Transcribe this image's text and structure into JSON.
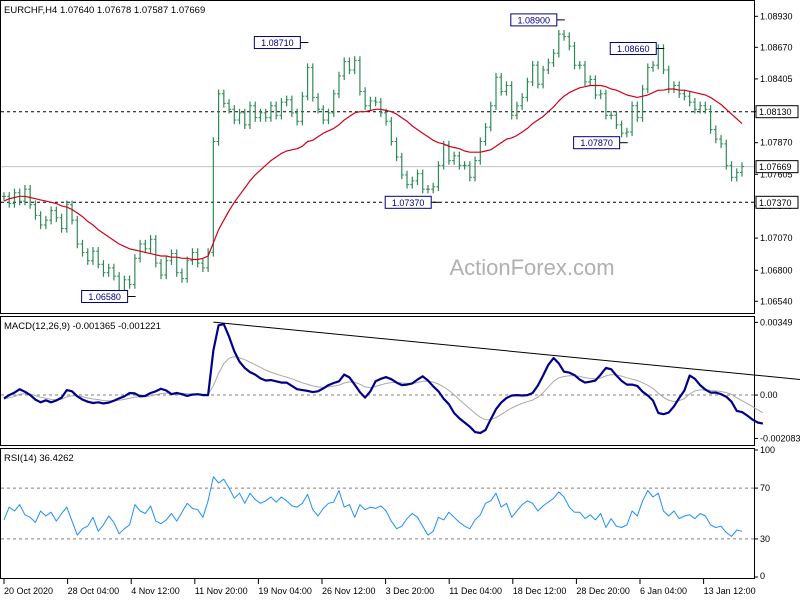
{
  "chart_data": [
    {
      "type": "line",
      "panel": "price",
      "header": "EURCHF,H4  1.07640 1.07678 1.07587 1.07669",
      "symbol": "EURCHF",
      "timeframe": "H4",
      "ohlc_header": {
        "open": 1.0764,
        "high": 1.07678,
        "low": 1.07587,
        "close": 1.07669
      },
      "ylim": [
        1.0645,
        1.0905
      ],
      "y_ticks": [
        "1.08930",
        "1.08670",
        "1.08405",
        "1.08130",
        "1.07870",
        "1.07605",
        "1.07340",
        "1.07070",
        "1.06800",
        "1.06540"
      ],
      "last_price_label": "1.07669",
      "last_price": 1.07669,
      "levels": [
        {
          "label": "1.08130",
          "value": 1.0813
        },
        {
          "label": "1.07370",
          "value": 1.0737
        }
      ],
      "annotations": [
        {
          "text": "1.06580",
          "value": 1.0658,
          "time_index": 24
        },
        {
          "text": "1.08710",
          "value": 1.0871,
          "time_index": 57
        },
        {
          "text": "1.07370",
          "value": 1.0737,
          "time_index": 82
        },
        {
          "text": "1.08900",
          "value": 1.089,
          "time_index": 106
        },
        {
          "text": "1.07870",
          "value": 1.0787,
          "time_index": 118
        },
        {
          "text": "1.08660",
          "value": 1.0866,
          "time_index": 125
        }
      ],
      "series": [
        {
          "name": "Price",
          "values": [
            1.0742,
            1.0736,
            1.0745,
            1.0738,
            1.0748,
            1.0735,
            1.0726,
            1.0718,
            1.0722,
            1.073,
            1.0724,
            1.0715,
            1.0735,
            1.0722,
            1.0702,
            1.0695,
            1.0688,
            1.0696,
            1.0685,
            1.0678,
            1.0682,
            1.0675,
            1.0662,
            1.0672,
            1.0668,
            1.069,
            1.0702,
            1.0698,
            1.0706,
            1.0686,
            1.0676,
            1.0688,
            1.0694,
            1.0678,
            1.0673,
            1.0688,
            1.0695,
            1.0686,
            1.0682,
            1.0695,
            1.0788,
            1.0828,
            1.082,
            1.0815,
            1.0806,
            1.0812,
            1.0802,
            1.0818,
            1.0808,
            1.0812,
            1.0808,
            1.0818,
            1.081,
            1.0821,
            1.0823,
            1.0812,
            1.0805,
            1.0826,
            1.085,
            1.0825,
            1.0815,
            1.0806,
            1.0812,
            1.0828,
            1.0843,
            1.0855,
            1.0848,
            1.0856,
            1.083,
            1.0818,
            1.0822,
            1.0821,
            1.0812,
            1.0805,
            1.0788,
            1.0775,
            1.076,
            1.0752,
            1.0755,
            1.0761,
            1.0748,
            1.0748,
            1.075,
            1.0768,
            1.0785,
            1.0772,
            1.0776,
            1.0768,
            1.0768,
            1.0758,
            1.0772,
            1.0788,
            1.08,
            1.0818,
            1.0842,
            1.083,
            1.0835,
            1.081,
            1.0818,
            1.0825,
            1.0838,
            1.0852,
            1.0836,
            1.0848,
            1.0854,
            1.0862,
            1.0878,
            1.0876,
            1.0868,
            1.0852,
            1.0852,
            1.0838,
            1.084,
            1.0827,
            1.0828,
            1.081,
            1.081,
            1.0802,
            1.0795,
            1.0796,
            1.0818,
            1.0808,
            1.0832,
            1.085,
            1.0852,
            1.0866,
            1.0848,
            1.0832,
            1.0835,
            1.0828,
            1.0826,
            1.0821,
            1.0815,
            1.0818,
            1.0815,
            1.0798,
            1.079,
            1.0786,
            1.0768,
            1.0758,
            1.0762,
            1.0767
          ]
        },
        {
          "name": "MA",
          "values": [
            1.0738,
            1.074,
            1.0741,
            1.0742,
            1.0742,
            1.0741,
            1.074,
            1.0739,
            1.0738,
            1.0737,
            1.0736,
            1.0734,
            1.0733,
            1.0731,
            1.0728,
            1.0725,
            1.0721,
            1.0718,
            1.0714,
            1.0711,
            1.0708,
            1.0705,
            1.0702,
            1.07,
            1.0698,
            1.0697,
            1.0696,
            1.0695,
            1.0694,
            1.0693,
            1.0692,
            1.0692,
            1.0691,
            1.0691,
            1.069,
            1.069,
            1.0689,
            1.0689,
            1.069,
            1.0692,
            1.0703,
            1.0714,
            1.0722,
            1.073,
            1.0737,
            1.0743,
            1.0749,
            1.0755,
            1.076,
            1.0764,
            1.0768,
            1.0772,
            1.0775,
            1.0778,
            1.078,
            1.0781,
            1.0782,
            1.0784,
            1.0788,
            1.0789,
            1.0792,
            1.0795,
            1.0797,
            1.0799,
            1.0802,
            1.0806,
            1.0809,
            1.0812,
            1.0813,
            1.0813,
            1.0814,
            1.0815,
            1.0815,
            1.0814,
            1.0813,
            1.0811,
            1.0808,
            1.0805,
            1.0801,
            1.0798,
            1.0795,
            1.0792,
            1.0789,
            1.0787,
            1.0786,
            1.0784,
            1.0783,
            1.0782,
            1.078,
            1.0779,
            1.0779,
            1.0779,
            1.078,
            1.0781,
            1.0784,
            1.0787,
            1.079,
            1.0791,
            1.0793,
            1.0796,
            1.0799,
            1.0803,
            1.0806,
            1.0809,
            1.0813,
            1.0817,
            1.0822,
            1.0826,
            1.0829,
            1.0831,
            1.0833,
            1.0834,
            1.0835,
            1.0835,
            1.0835,
            1.0834,
            1.0832,
            1.0831,
            1.0829,
            1.0827,
            1.0826,
            1.0825,
            1.0826,
            1.0827,
            1.0829,
            1.0831,
            1.0831,
            1.0832,
            1.0832,
            1.0831,
            1.0831,
            1.083,
            1.0829,
            1.0828,
            1.0827,
            1.0825,
            1.0822,
            1.0819,
            1.0815,
            1.0811,
            1.0807,
            1.0803
          ]
        }
      ],
      "colors": {
        "price": "#2e8b57",
        "ma": "#d0021b",
        "label_fill": "#ffffff",
        "label_border": "#000080",
        "label_text": "#000080"
      }
    },
    {
      "type": "line",
      "panel": "macd",
      "header": "MACD(12,26,9) -0.001365 -0.001221",
      "indicator": "MACD",
      "params": [
        12,
        26,
        9
      ],
      "current_values": [
        -0.001365,
        -0.001221
      ],
      "ylim": [
        -0.00235,
        0.0037
      ],
      "y_ticks": [
        "0.00349",
        "0.00",
        "-0.002083"
      ],
      "reference_value_labels": [
        "0.00349",
        "0.00",
        "-0.002083"
      ],
      "zero_line": 0,
      "trendline": {
        "start_index": 40,
        "start_value": 0.0035,
        "end_index": 154,
        "end_value": 0.0007
      },
      "series": [
        {
          "name": "MACD",
          "values": [
            -0.00016,
            0.0,
            0.00012,
            0.00028,
            0.00016,
            0.0,
            -0.00022,
            -0.00035,
            -0.00025,
            -0.00035,
            -0.00026,
            -0.00012,
            0.00024,
            0.00018,
            -6e-05,
            -0.00022,
            -0.00032,
            -0.00038,
            -0.00035,
            -0.0004,
            -0.00036,
            -0.00027,
            -0.00016,
            -6e-05,
            0.0001,
            8e-05,
            -6e-05,
            -4e-05,
            0.0001,
            0.00018,
            0.0003,
            0.00022,
            4e-05,
            0.0001,
            4e-05,
            -4e-05,
            2e-05,
            4e-05,
            0.0,
            0.0,
            0.00215,
            0.00335,
            0.0034,
            0.0028,
            0.0021,
            0.0016,
            0.0013,
            0.0011,
            0.00098,
            0.0008,
            0.0007,
            0.00072,
            0.00066,
            0.0006,
            0.0006,
            0.00044,
            0.00028,
            0.00024,
            0.0002,
            0.00014,
            0.00018,
            0.00032,
            0.00048,
            0.00058,
            0.00066,
            0.00098,
            0.00085,
            0.0005,
            0.00014,
            -0.00012,
            0.00018,
            0.00066,
            0.00078,
            0.00086,
            0.00076,
            0.0006,
            0.00048,
            0.0005,
            0.00056,
            0.00074,
            0.0009,
            0.0007,
            0.00042,
            0.00018,
            -0.00018,
            -0.00044,
            -0.00086,
            -0.00112,
            -0.00132,
            -0.00152,
            -0.00178,
            -0.00182,
            -0.00168,
            -0.00116,
            -0.00068,
            -0.00036,
            -0.00014,
            -2e-05,
            0.0,
            -2e-05,
            0.0,
            0.0001,
            0.00046,
            0.00094,
            0.00145,
            0.00178,
            0.00152,
            0.00112,
            0.00108,
            0.00096,
            0.00074,
            0.0006,
            0.00064,
            0.0007,
            0.00098,
            0.0013,
            0.00124,
            0.00094,
            0.00068,
            0.0005,
            0.0005,
            0.00044,
            0.00016,
            -2e-05,
            -0.00026,
            -0.00086,
            -0.00092,
            -0.00084,
            -0.00054,
            -0.00014,
            0.00022,
            0.00094,
            0.00078,
            0.00048,
            0.00026,
            0.00012,
            0.00012,
            4e-05,
            -8e-05,
            -0.00032,
            -0.00076,
            -0.00082,
            -0.00098,
            -0.00118,
            -0.00132,
            -0.00137
          ]
        },
        {
          "name": "Signal",
          "values": [
            -0.0002,
            -0.00013,
            -7e-05,
            4e-05,
            7e-05,
            5e-05,
            -2e-05,
            -0.00011,
            -0.00015,
            -0.00021,
            -0.00022,
            -0.0002,
            -9e-05,
            -3e-05,
            -4e-05,
            -8e-05,
            -0.00014,
            -0.00019,
            -0.00022,
            -0.00026,
            -0.00028,
            -0.00028,
            -0.00025,
            -0.00021,
            -0.00015,
            -0.0001,
            -9e-05,
            -8e-05,
            -4e-05,
            1e-05,
            7e-05,
            0.0001,
            9e-05,
            9e-05,
            8e-05,
            6e-05,
            5e-05,
            5e-05,
            4e-05,
            3e-05,
            0.00046,
            0.00104,
            0.00151,
            0.00177,
            0.00184,
            0.00179,
            0.0017,
            0.00158,
            0.00146,
            0.00133,
            0.0012,
            0.0011,
            0.00101,
            0.00093,
            0.00086,
            0.00078,
            0.00068,
            0.00059,
            0.00051,
            0.00044,
            0.00039,
            0.00037,
            0.00039,
            0.00043,
            0.00048,
            0.00058,
            0.00063,
            0.00061,
            0.00052,
            0.00039,
            0.00035,
            0.00041,
            0.00049,
            0.00056,
            0.0006,
            0.0006,
            0.00058,
            0.00056,
            0.00056,
            0.0006,
            0.00066,
            0.00067,
            0.00062,
            0.00053,
            0.00039,
            0.00022,
            1e-05,
            -0.00022,
            -0.00044,
            -0.00066,
            -0.00088,
            -0.00107,
            -0.00119,
            -0.00118,
            -0.00108,
            -0.00093,
            -0.00077,
            -0.00062,
            -0.0005,
            -0.0004,
            -0.00032,
            -0.00024,
            -0.0001,
            0.00011,
            0.00038,
            0.00066,
            0.00083,
            0.00089,
            0.00093,
            0.00093,
            0.0009,
            0.00084,
            0.0008,
            0.00078,
            0.00082,
            0.00092,
            0.00098,
            0.00097,
            0.00091,
            0.00083,
            0.00076,
            0.0007,
            0.00059,
            0.00047,
            0.00032,
            9e-05,
            -0.00011,
            -0.00025,
            -0.00031,
            -0.00027,
            -0.00017,
            5e-05,
            0.0002,
            0.00025,
            0.00025,
            0.00022,
            0.0002,
            0.00017,
            0.00012,
            3e-05,
            -0.00013,
            -0.00027,
            -0.00041,
            -0.00056,
            -0.00071,
            -0.00084
          ]
        }
      ],
      "colors": {
        "macd": "#00008b",
        "signal": "#a9a9a9",
        "trendline": "#000000",
        "zero_line": "#808080"
      }
    },
    {
      "type": "line",
      "panel": "rsi",
      "header": "RSI(14) 36.4262",
      "indicator": "RSI",
      "period": 14,
      "current_value": 36.4262,
      "ylim": [
        0,
        100
      ],
      "y_ticks": [
        "100",
        "70",
        "30",
        "0"
      ],
      "levels": [
        70,
        30
      ],
      "series": [
        {
          "name": "RSI",
          "values": [
            45,
            55,
            52,
            57,
            49,
            47,
            43,
            52,
            48,
            51,
            44,
            50,
            55,
            44,
            33,
            38,
            40,
            47,
            36,
            41,
            48,
            43,
            34,
            38,
            41,
            57,
            52,
            50,
            56,
            44,
            42,
            45,
            50,
            44,
            51,
            58,
            54,
            53,
            47,
            60,
            79,
            74,
            77,
            70,
            62,
            66,
            58,
            66,
            61,
            58,
            60,
            63,
            59,
            63,
            60,
            56,
            55,
            58,
            65,
            53,
            48,
            54,
            58,
            59,
            68,
            55,
            57,
            47,
            57,
            53,
            55,
            54,
            56,
            52,
            44,
            38,
            40,
            46,
            50,
            47,
            40,
            33,
            36,
            47,
            45,
            51,
            47,
            43,
            40,
            38,
            45,
            49,
            58,
            60,
            66,
            55,
            58,
            47,
            52,
            57,
            60,
            58,
            52,
            56,
            59,
            62,
            67,
            63,
            55,
            51,
            51,
            46,
            49,
            45,
            50,
            39,
            46,
            40,
            39,
            41,
            52,
            48,
            60,
            68,
            63,
            66,
            52,
            48,
            52,
            46,
            48,
            49,
            46,
            50,
            48,
            41,
            39,
            40,
            35,
            32,
            37,
            36
          ]
        }
      ],
      "colors": {
        "rsi": "#1e90ff",
        "level_line": "#808080"
      }
    }
  ],
  "x_axis": {
    "labels": [
      "20 Oct 2020",
      "28 Oct 04:00",
      "4 Nov 12:00",
      "11 Nov 20:00",
      "19 Nov 04:00",
      "26 Nov 12:00",
      "3 Dec 20:00",
      "11 Dec 04:00",
      "18 Dec 12:00",
      "28 Dec 20:00",
      "6 Jan 04:00",
      "13 Jan 12:00"
    ]
  },
  "watermark": "ActionForex.com"
}
